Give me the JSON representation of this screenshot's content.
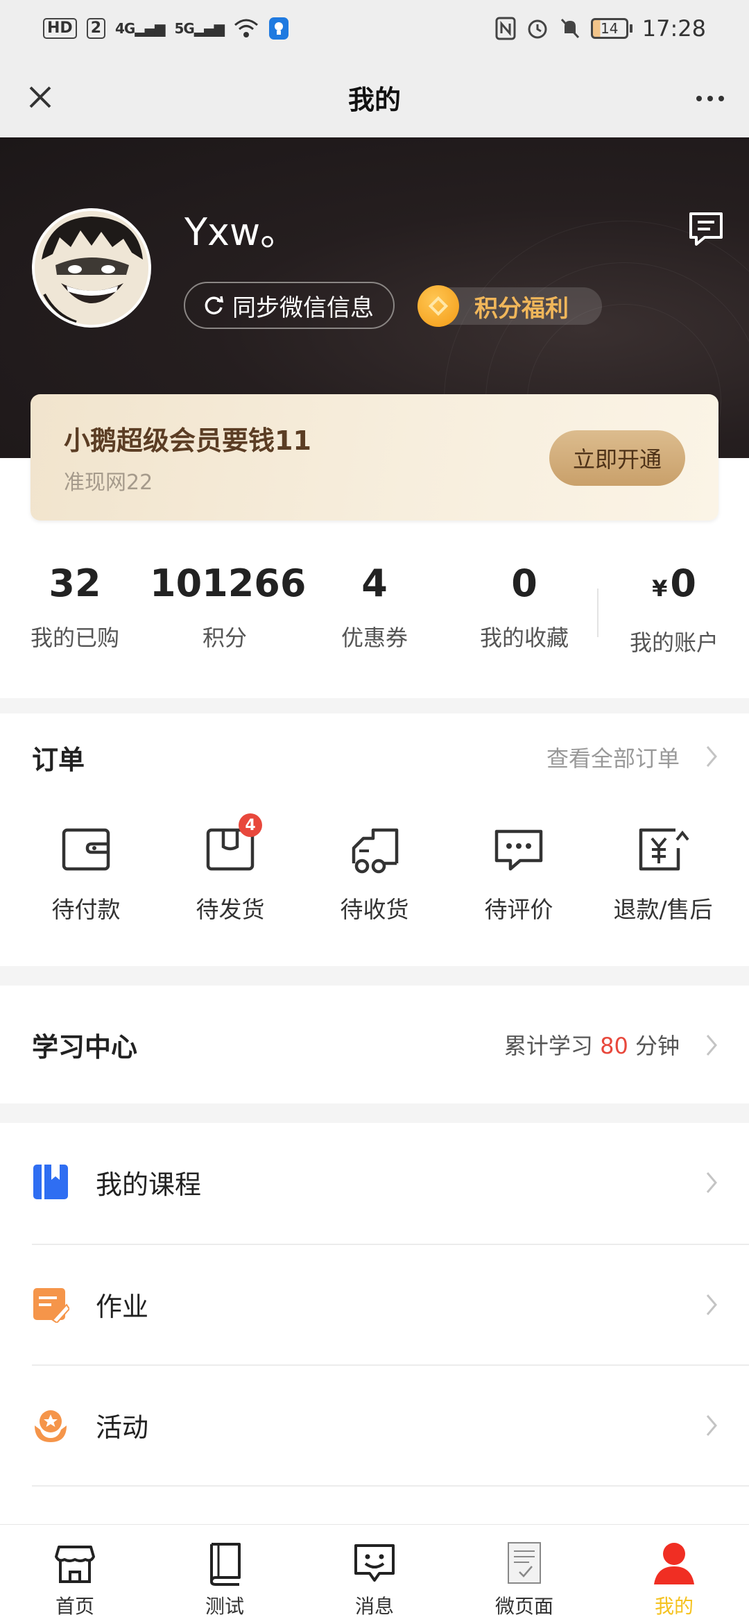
{
  "status_bar": {
    "network_chip": "HD",
    "sim": "2",
    "signal1": "4G",
    "signal2": "5G",
    "battery": "14",
    "time": "17:28"
  },
  "nav": {
    "title": "我的"
  },
  "profile": {
    "username": "Yxw。",
    "sync_label": "同步微信信息",
    "points_label": "积分福利"
  },
  "vip": {
    "title": "小鹅超级会员要钱11",
    "subtitle": "准现网22",
    "button": "立即开通"
  },
  "stats": [
    {
      "value": "32",
      "label": "我的已购"
    },
    {
      "value": "101266",
      "label": "积分"
    },
    {
      "value": "4",
      "label": "优惠券"
    },
    {
      "value": "0",
      "label": "我的收藏"
    },
    {
      "currency": "¥",
      "value": "0",
      "label": "我的账户"
    }
  ],
  "orders": {
    "title": "订单",
    "view_all": "查看全部订单",
    "items": [
      {
        "label": "待付款",
        "icon": "wallet-icon"
      },
      {
        "label": "待发货",
        "icon": "package-icon",
        "badge": "4"
      },
      {
        "label": "待收货",
        "icon": "truck-icon"
      },
      {
        "label": "待评价",
        "icon": "comment-icon"
      },
      {
        "label": "退款/售后",
        "icon": "refund-icon"
      }
    ]
  },
  "study": {
    "title": "学习中心",
    "prefix": "累计学习",
    "minutes": "80",
    "suffix": "分钟",
    "accent": "#e8483c"
  },
  "menu": [
    {
      "label": "我的课程",
      "icon": "course-icon",
      "color": "#2f6ef2"
    },
    {
      "label": "作业",
      "icon": "homework-icon",
      "color": "#f5954a"
    },
    {
      "label": "活动",
      "icon": "activity-icon",
      "color": "#f5954a"
    }
  ],
  "tabs": [
    {
      "label": "首页",
      "icon": "home-icon"
    },
    {
      "label": "测试",
      "icon": "book-icon"
    },
    {
      "label": "消息",
      "icon": "message-icon"
    },
    {
      "label": "微页面",
      "icon": "page-icon"
    },
    {
      "label": "我的",
      "icon": "user-icon",
      "active": true,
      "color": "#f5c21f"
    }
  ]
}
